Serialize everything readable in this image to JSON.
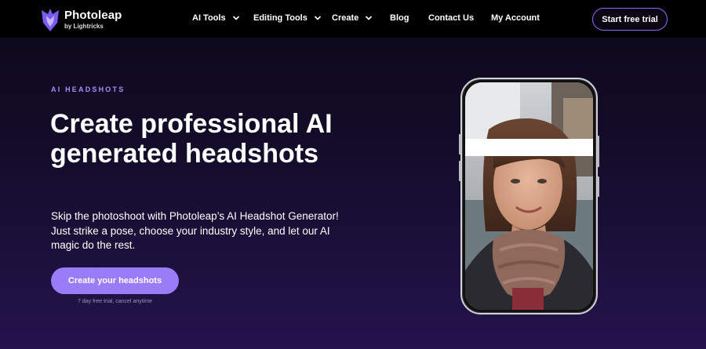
{
  "nav": {
    "logo_title": "Photoleap",
    "logo_sub": "by Lightricks",
    "items": [
      {
        "label": "AI Tools"
      },
      {
        "label": "Editing Tools"
      },
      {
        "label": "Create"
      },
      {
        "label": "Blog"
      },
      {
        "label": "Contact Us"
      },
      {
        "label": "My Account"
      }
    ],
    "cta_label": "Start free trial"
  },
  "hero": {
    "eyebrow": "AI HEADSHOTS",
    "headline": "Create professional AI generated headshots",
    "subtext": "Skip the photoshoot with Photoleap’s AI Headshot Generator! Just strike a pose, choose your industry style, and let our AI magic do the rest.",
    "cta_label": "Create your headshots",
    "trial_note": "7 day free trial, cancel anytime"
  },
  "icons": {
    "logo": "photoleap-logo-icon",
    "dropdown": "chevron-down-icon"
  },
  "colors": {
    "accent": "#9b7cf8",
    "accent_border": "#8b6cf6",
    "eyebrow": "#a98bff",
    "nav_bg": "#000000",
    "page_bg_top": "#0c0918",
    "page_bg_bottom": "#25134d"
  }
}
